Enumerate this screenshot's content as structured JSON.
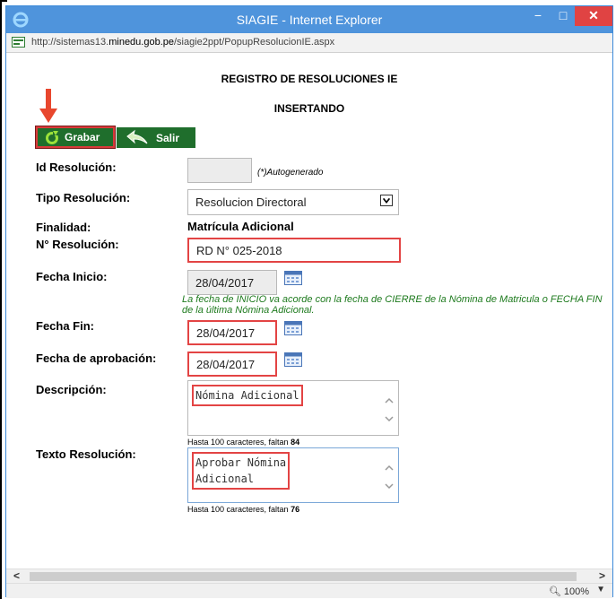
{
  "window": {
    "title": "SIAGIE - Internet Explorer",
    "minimize": "−",
    "maximize": "□",
    "close": "✕"
  },
  "address": {
    "prefix": "http://sistemas13.",
    "domain": "minedu.gob.pe",
    "path": "/siagie2ppt/PopupResolucionIE.aspx"
  },
  "page": {
    "heading": "REGISTRO DE RESOLUCIONES IE",
    "mode": "INSERTANDO"
  },
  "toolbar": {
    "grabar_label": "Grabar",
    "salir_label": "Salir"
  },
  "form": {
    "id_label": "Id Resolución:",
    "id_value": "",
    "id_note": "(*)Autogenerado",
    "tipo_label": "Tipo Resolución:",
    "tipo_value": "Resolucion Directoral",
    "finalidad_label": "Finalidad:",
    "finalidad_value": "Matrícula Adicional",
    "numero_label": "N° Resolución:",
    "numero_value": "RD N° 025-2018",
    "inicio_label": "Fecha Inicio:",
    "inicio_value": "28/04/2017",
    "inicio_note": "La fecha de INICIO va acorde con la fecha de CIERRE de la Nómina de Matricula o FECHA FIN de la última Nómina Adicional.",
    "fin_label": "Fecha Fin:",
    "fin_value": "28/04/2017",
    "aprobacion_label": "Fecha de aprobación:",
    "aprobacion_value": "28/04/2017",
    "descripcion_label": "Descripción:",
    "descripcion_value": "Nómina Adicional",
    "descripcion_hint_prefix": "Hasta 100 caracteres, faltan ",
    "descripcion_hint_count": "84",
    "texto_label": "Texto Resolución:",
    "texto_value": "Aprobar Nómina\nAdicional",
    "texto_hint_prefix": "Hasta 100 caracteres, faltan ",
    "texto_hint_count": "76"
  },
  "status": {
    "zoom": "100%"
  },
  "colors": {
    "titlebar": "#4f94dc",
    "button_green": "#1f6e2c",
    "highlight_red": "#e34444",
    "note_green": "#1d7a1d"
  }
}
